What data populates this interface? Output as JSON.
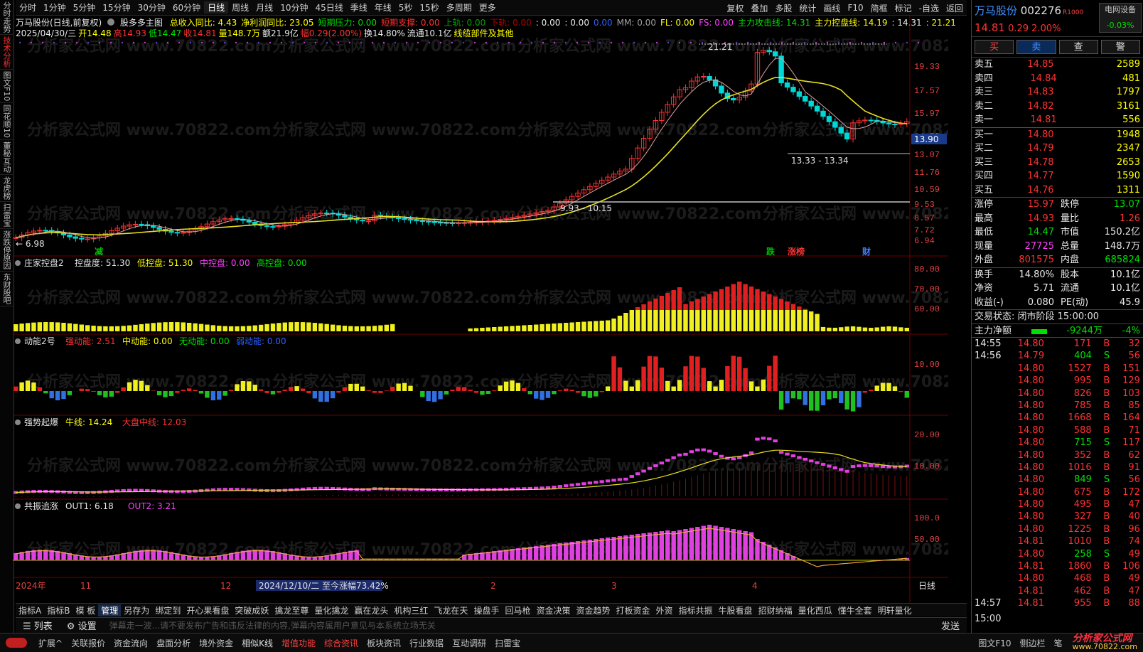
{
  "sidebar": [
    "分时走势",
    "技术分析",
    "图文F10",
    "同花顺10",
    "董秘互动",
    "龙虎榜",
    "扫雷宝",
    "涨跌停原因",
    "东财股吧"
  ],
  "topbar": {
    "periods": [
      "分时",
      "1分钟",
      "5分钟",
      "15分钟",
      "30分钟",
      "60分钟",
      "日线",
      "周线",
      "月线",
      "10分钟",
      "45日线",
      "季线",
      "年线",
      "5秒",
      "15秒",
      "多周期",
      "更多"
    ],
    "active_period": "日线",
    "tools": [
      "复权",
      "叠加",
      "多股",
      "统计",
      "画线",
      "F10",
      "简框",
      "标记",
      "-自选",
      "返回"
    ]
  },
  "header": {
    "title": "万马股份(日线,前复权)",
    "indicator": "股多多主图",
    "line1": [
      {
        "t": "总收入同比: 4.43",
        "c": "yellow"
      },
      {
        "t": "净利润同比: 23.05",
        "c": "yellow"
      },
      {
        "t": "短期压力: 0.00",
        "c": "green"
      },
      {
        "t": "短期支撑: 0.00",
        "c": "red"
      },
      {
        "t": "上轨: 0.00",
        "c": "dgreen"
      },
      {
        "t": "下轨: 0.00",
        "c": "dred"
      },
      {
        "t": ": 0.00",
        "c": "white"
      },
      {
        "t": ": 0.00",
        "c": "white"
      },
      {
        "t": "0.00",
        "c": "blue"
      },
      {
        "t": "MM: 0.00",
        "c": "grey"
      },
      {
        "t": "FL: 0.00",
        "c": "yellow"
      },
      {
        "t": "FS: 0.00",
        "c": "mag"
      },
      {
        "t": "主力攻击线: 14.31",
        "c": "green"
      },
      {
        "t": "主力控盘线: 14.19",
        "c": "yellow"
      },
      {
        "t": ": 14.31",
        "c": "white"
      },
      {
        "t": ": 21.21",
        "c": "yellow"
      }
    ],
    "line2": [
      {
        "t": "2025/04/30/三",
        "c": "white"
      },
      {
        "t": "开14.48",
        "c": "yellow"
      },
      {
        "t": "高14.93",
        "c": "red"
      },
      {
        "t": "低14.47",
        "c": "green"
      },
      {
        "t": "收14.81",
        "c": "red"
      },
      {
        "t": "量148.7万",
        "c": "yellow"
      },
      {
        "t": "额21.9亿",
        "c": "white"
      },
      {
        "t": "幅0.29(2.00%)",
        "c": "red"
      },
      {
        "t": "换14.80%",
        "c": "white"
      },
      {
        "t": "流通10.1亿",
        "c": "white"
      },
      {
        "t": "线缆部件及其他",
        "c": "yellow"
      }
    ]
  },
  "price_axis": [
    "19.33",
    "17.57",
    "15.97",
    "14.52",
    "13.07",
    "11.76",
    "10.59",
    "9.53",
    "8.57",
    "7.72",
    "6.94"
  ],
  "current_price_tag": "13.90",
  "annotations": {
    "high": "21.21",
    "low": "6.98",
    "range1": "9.93 - 10.15",
    "range2": "13.33 - 13.34",
    "marks": [
      "减",
      "跌",
      "涨榜",
      "财"
    ]
  },
  "panels": {
    "zj": {
      "name": "庄家控盘2",
      "items": [
        {
          "t": "控盘度: 51.30",
          "c": "white"
        },
        {
          "t": "低控盘: 51.30",
          "c": "yellow"
        },
        {
          "t": "中控盘: 0.00",
          "c": "mag"
        },
        {
          "t": "高控盘: 0.00",
          "c": "green"
        }
      ],
      "axis": [
        "80.00",
        "70.00",
        "60.00"
      ]
    },
    "dn": {
      "name": "动能2号",
      "items": [
        {
          "t": "强动能: 2.51",
          "c": "red"
        },
        {
          "t": "中动能: 0.00",
          "c": "yellow"
        },
        {
          "t": "无动能: 0.00",
          "c": "green"
        },
        {
          "t": "弱动能: 0.00",
          "c": "blue"
        }
      ],
      "axis": [
        "10.00"
      ]
    },
    "qs": {
      "name": "强势起爆",
      "items": [
        {
          "t": "牛线: 14.24",
          "c": "yellow"
        },
        {
          "t": "大盘中线: 12.03",
          "c": "red"
        }
      ],
      "axis": [
        "20.00",
        "10.00"
      ]
    },
    "gz": {
      "name": "共振追涨",
      "items": [
        {
          "t": "OUT1: 6.18",
          "c": "white"
        },
        {
          "t": "OUT2: 3.21",
          "c": "mag"
        }
      ],
      "axis": [
        "100.0",
        "50.00"
      ]
    }
  },
  "xaxis": {
    "labels": [
      "2024年",
      "11",
      "12",
      "2",
      "3",
      "4"
    ],
    "range_note": "2024/12/10/二  至今涨幅73.42%",
    "period": "日线"
  },
  "bottom_tabs": [
    "指标A",
    "指标B",
    "模 板",
    "管理",
    "另存为",
    "绑定到",
    "开心果看盘",
    "突破成妖",
    "擒龙至尊",
    "量化擒龙",
    "赢在龙头",
    "机构三红",
    "飞龙在天",
    "操盘手",
    "回马枪",
    "资金决策",
    "资金趋势",
    "打板资金",
    "外资",
    "指标共振",
    "牛股看盘",
    "招财纳福",
    "量化西瓜",
    "懂牛全套",
    "明轩量化"
  ],
  "active_tab": "管理",
  "right": {
    "name": "万马股份",
    "code": "002276",
    "tag": "R1000",
    "sector": "电网设备",
    "sector_chg": "-0.03%",
    "price": "14.81",
    "chg": "0.29",
    "pct": "2.00%",
    "buttons": [
      "买",
      "卖",
      "查",
      "警"
    ],
    "asks": [
      [
        "卖五",
        "14.85",
        "2589"
      ],
      [
        "卖四",
        "14.84",
        "481"
      ],
      [
        "卖三",
        "14.83",
        "1797"
      ],
      [
        "卖二",
        "14.82",
        "3161"
      ],
      [
        "卖一",
        "14.81",
        "556"
      ]
    ],
    "bids": [
      [
        "买一",
        "14.80",
        "1948"
      ],
      [
        "买二",
        "14.79",
        "2347"
      ],
      [
        "买三",
        "14.78",
        "2653"
      ],
      [
        "买四",
        "14.77",
        "1590"
      ],
      [
        "买五",
        "14.76",
        "1311"
      ]
    ],
    "stats": [
      [
        [
          "涨停",
          "15.97",
          "red"
        ],
        [
          "跌停",
          "13.07",
          "green"
        ]
      ],
      [
        [
          "最高",
          "14.93",
          "red"
        ],
        [
          "量比",
          "1.26",
          "red"
        ]
      ],
      [
        [
          "最低",
          "14.47",
          "green"
        ],
        [
          "市值",
          "150.2亿",
          "white"
        ]
      ],
      [
        [
          "现量",
          "27725",
          "mag"
        ],
        [
          "总量",
          "148.7万",
          "white"
        ]
      ],
      [
        [
          "外盘",
          "801575",
          "red"
        ],
        [
          "内盘",
          "685824",
          "green"
        ]
      ]
    ],
    "stats2": [
      [
        [
          "换手",
          "14.80%",
          "white"
        ],
        [
          "股本",
          "10.1亿",
          "white"
        ]
      ],
      [
        [
          "净资",
          "5.71",
          "white"
        ],
        [
          "流通",
          "10.1亿",
          "white"
        ]
      ],
      [
        [
          "收益(-)",
          "0.080",
          "white"
        ],
        [
          "PE(动)",
          "45.9",
          "white"
        ]
      ]
    ],
    "trade_status": "交易状态: 闭市阶段 15:00:00",
    "main_flow_label": "主力净额",
    "main_flow": "-9244万",
    "main_flow_pct": "-4%",
    "ticks": [
      [
        "14:55",
        "14.80",
        "171",
        "B",
        "32"
      ],
      [
        "14:56",
        "14.79",
        "404",
        "S",
        "56"
      ],
      [
        "",
        "14.80",
        "1527",
        "B",
        "151"
      ],
      [
        "",
        "14.80",
        "995",
        "B",
        "129"
      ],
      [
        "",
        "14.80",
        "826",
        "B",
        "103"
      ],
      [
        "",
        "14.80",
        "785",
        "B",
        "85"
      ],
      [
        "",
        "14.80",
        "1668",
        "B",
        "164"
      ],
      [
        "",
        "14.80",
        "588",
        "B",
        "71"
      ],
      [
        "",
        "14.80",
        "715",
        "S",
        "117"
      ],
      [
        "",
        "14.80",
        "352",
        "B",
        "62"
      ],
      [
        "",
        "14.80",
        "1016",
        "B",
        "91"
      ],
      [
        "",
        "14.80",
        "849",
        "S",
        "56"
      ],
      [
        "",
        "14.80",
        "675",
        "B",
        "172"
      ],
      [
        "",
        "14.80",
        "495",
        "B",
        "47"
      ],
      [
        "",
        "14.80",
        "327",
        "B",
        "40"
      ],
      [
        "",
        "14.80",
        "1225",
        "B",
        "96"
      ],
      [
        "",
        "14.81",
        "1010",
        "B",
        "74"
      ],
      [
        "",
        "14.80",
        "258",
        "S",
        "49"
      ],
      [
        "",
        "14.81",
        "1860",
        "B",
        "106"
      ],
      [
        "",
        "14.80",
        "468",
        "B",
        "49"
      ],
      [
        "",
        "14.81",
        "462",
        "B",
        "47"
      ],
      [
        "14:57",
        "14.81",
        "955",
        "B",
        "88"
      ]
    ],
    "bottom_time": "15:00"
  },
  "footer": {
    "left_buttons": [
      "列表",
      "设置"
    ],
    "notice": "弹幕走一波...请不要发布广告和违反法律的内容,弹幕内容属用户意见与本系统立场无关",
    "send": "发送",
    "status_tabs": [
      "扩展^",
      "关联报价",
      "资金流向",
      "盘面分析",
      "境外资金",
      "相似K线",
      "增值功能",
      "综合资讯",
      "板块资讯",
      "行业数据",
      "互动调研",
      "扫雷宝"
    ],
    "right_tabs": [
      "图文F10",
      "侧边栏",
      "笔"
    ],
    "brand": "分析家公式网",
    "brand_url": "www.70822.com"
  },
  "watermark": "分析家公式网 www.70822.com"
}
